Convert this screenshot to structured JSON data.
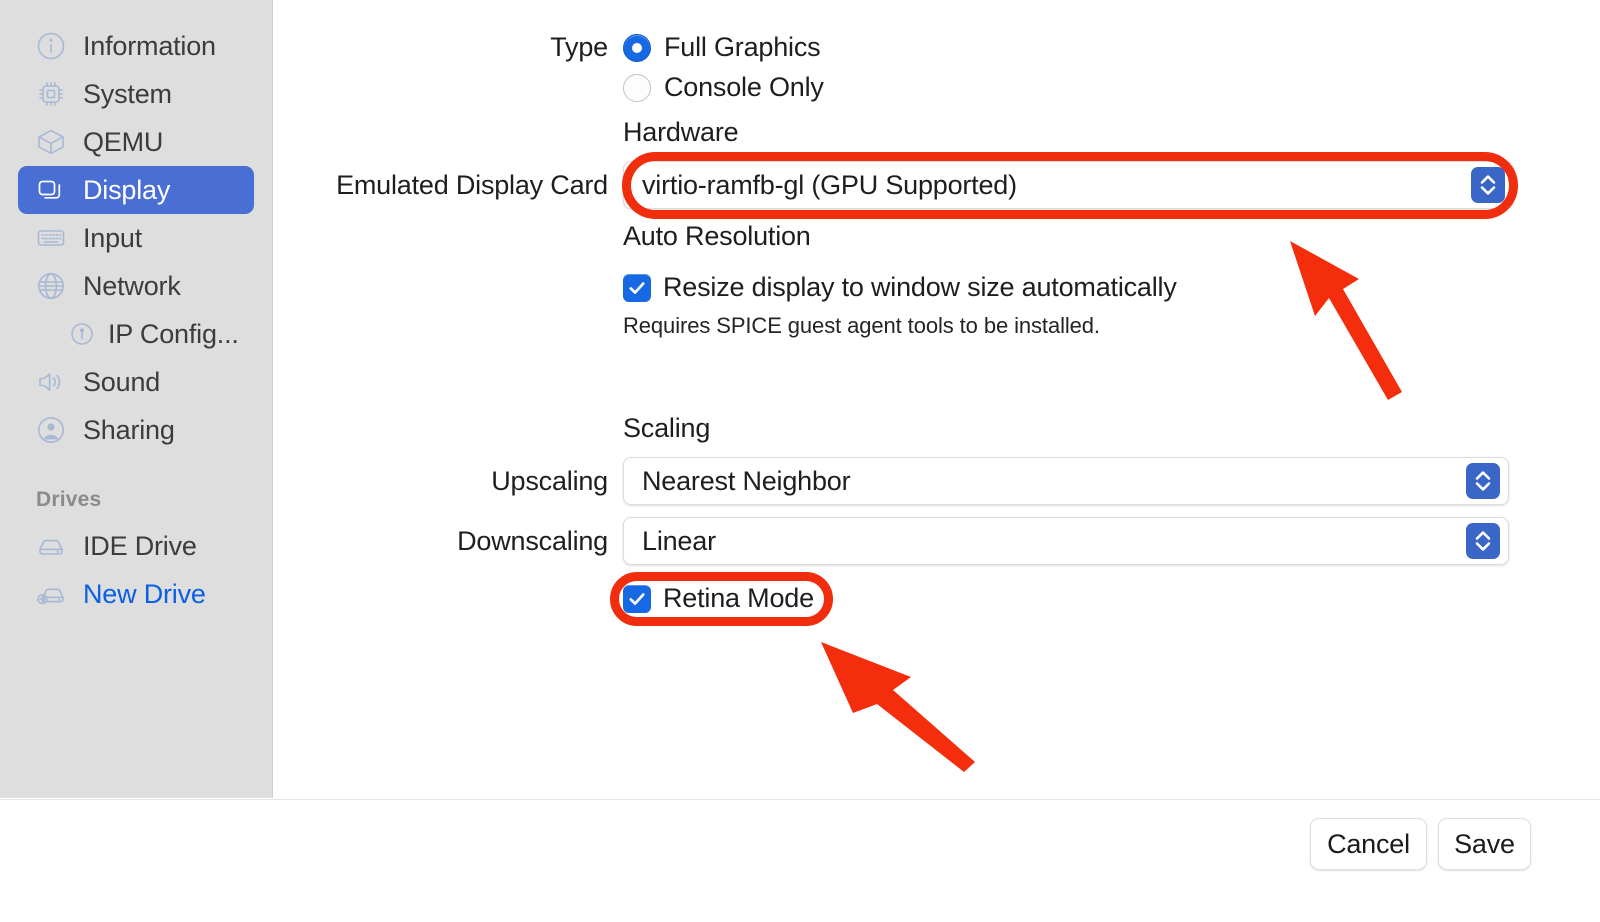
{
  "sidebar": {
    "items": [
      {
        "label": "Information",
        "icon": "info-circle-icon",
        "selected": false,
        "sub": false
      },
      {
        "label": "System",
        "icon": "cpu-icon",
        "selected": false,
        "sub": false
      },
      {
        "label": "QEMU",
        "icon": "box-icon",
        "selected": false,
        "sub": false
      },
      {
        "label": "Display",
        "icon": "display-windows-icon",
        "selected": true,
        "sub": false
      },
      {
        "label": "Input",
        "icon": "keyboard-icon",
        "selected": false,
        "sub": false
      },
      {
        "label": "Network",
        "icon": "globe-icon",
        "selected": false,
        "sub": false
      },
      {
        "label": "IP Config...",
        "icon": "ip-config-icon",
        "selected": false,
        "sub": true
      },
      {
        "label": "Sound",
        "icon": "speaker-icon",
        "selected": false,
        "sub": false
      },
      {
        "label": "Sharing",
        "icon": "person-circle-icon",
        "selected": false,
        "sub": false
      }
    ],
    "drives_header": "Drives",
    "drives": [
      {
        "label": "IDE Drive",
        "icon": "drive-icon",
        "link": false
      },
      {
        "label": "New Drive",
        "icon": "drive-plus-icon",
        "link": true
      }
    ]
  },
  "main": {
    "type_label": "Type",
    "type_options": [
      {
        "label": "Full Graphics",
        "selected": true
      },
      {
        "label": "Console Only",
        "selected": false
      }
    ],
    "hardware_header": "Hardware",
    "display_card_label": "Emulated Display Card",
    "display_card_value": "virtio-ramfb-gl (GPU Supported)",
    "auto_resolution_header": "Auto Resolution",
    "resize_checkbox_label": "Resize display to window size automatically",
    "resize_checked": true,
    "spice_note": "Requires SPICE guest agent tools to be installed.",
    "scaling_header": "Scaling",
    "upscaling_label": "Upscaling",
    "upscaling_value": "Nearest Neighbor",
    "downscaling_label": "Downscaling",
    "downscaling_value": "Linear",
    "retina_label": "Retina Mode",
    "retina_checked": true
  },
  "footer": {
    "cancel_label": "Cancel",
    "save_label": "Save"
  },
  "annotations": {
    "highlight_color": "#f02d0c",
    "arrow_color": "#f42d0c",
    "items": [
      {
        "name": "display-card-highlight",
        "shape": "ring"
      },
      {
        "name": "retina-mode-highlight",
        "shape": "ring"
      },
      {
        "name": "display-card-arrow",
        "shape": "arrow"
      },
      {
        "name": "retina-mode-arrow",
        "shape": "arrow"
      }
    ]
  },
  "colors": {
    "selection_blue": "#4a6fd4",
    "control_blue": "#1668e3",
    "link_blue": "#0a5fe4",
    "sidebar_bg": "#dedede"
  }
}
